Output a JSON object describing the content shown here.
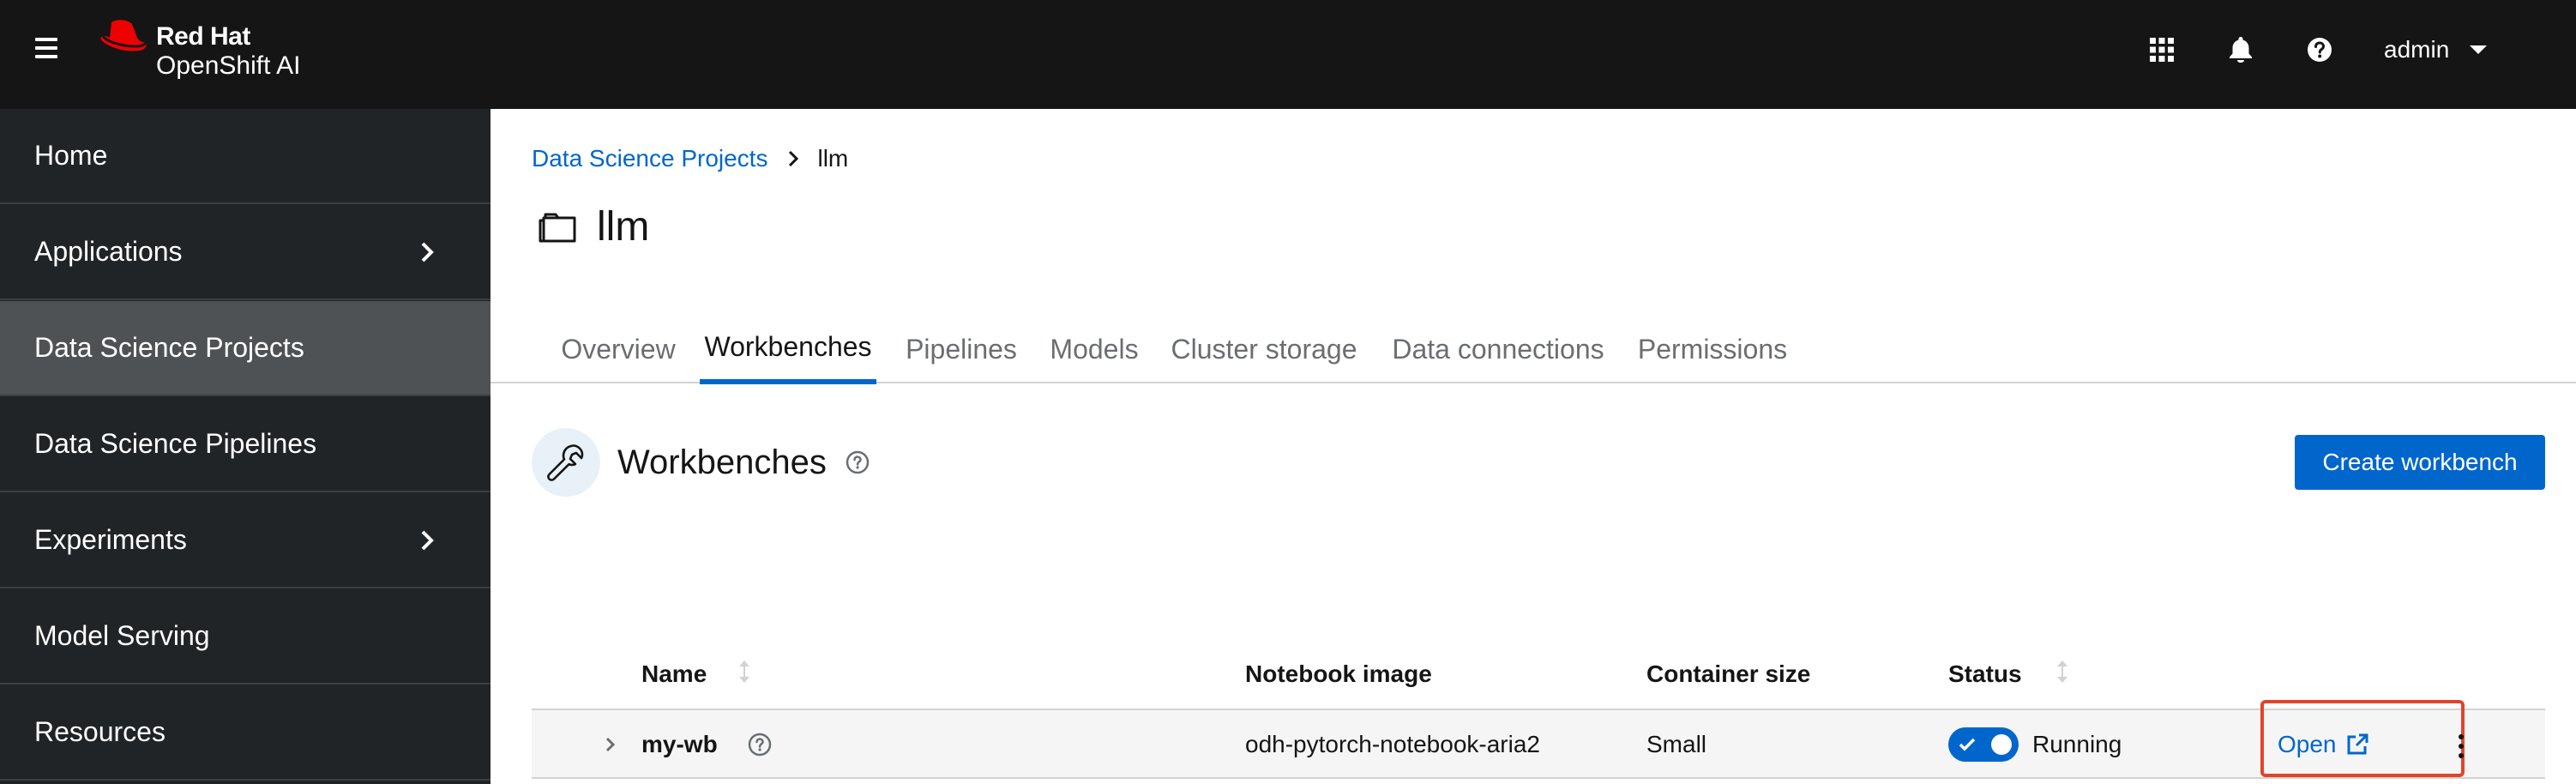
{
  "masthead": {
    "brand_line1": "Red Hat",
    "brand_line2": "OpenShift AI",
    "user_name": "admin",
    "icons": [
      "menu-icon",
      "app-launcher-grid-icon",
      "bell-icon",
      "help-icon",
      "caret-down-icon"
    ]
  },
  "sidebar": {
    "items": [
      {
        "label": "Home"
      },
      {
        "label": "Applications"
      },
      {
        "label": "Data Science Projects"
      },
      {
        "label": "Data Science Pipelines"
      },
      {
        "label": "Experiments"
      },
      {
        "label": "Model Serving"
      },
      {
        "label": "Resources"
      }
    ],
    "active": "Data Science Projects"
  },
  "breadcrumb": {
    "parent": "Data Science Projects",
    "current": "llm"
  },
  "page": {
    "title": "llm"
  },
  "tabs": [
    {
      "label": "Overview"
    },
    {
      "label": "Workbenches"
    },
    {
      "label": "Pipelines"
    },
    {
      "label": "Models"
    },
    {
      "label": "Cluster storage"
    },
    {
      "label": "Data connections"
    },
    {
      "label": "Permissions"
    }
  ],
  "active_tab": "Workbenches",
  "section": {
    "title": "Workbenches",
    "create_button": "Create workbench"
  },
  "table": {
    "columns": [
      "Name",
      "Notebook image",
      "Container size",
      "Status"
    ],
    "rows": [
      {
        "name": "my-wb",
        "notebook_image": "odh-pytorch-notebook-aria2",
        "container_size": "Small",
        "status": "Running",
        "action": "Open"
      }
    ]
  },
  "colors": {
    "masthead_bg": "#151515",
    "sidebar_bg": "#212427",
    "sidebar_active_bg": "#4f5255",
    "accent": "#0066cc",
    "highlight": "#e0452a"
  }
}
